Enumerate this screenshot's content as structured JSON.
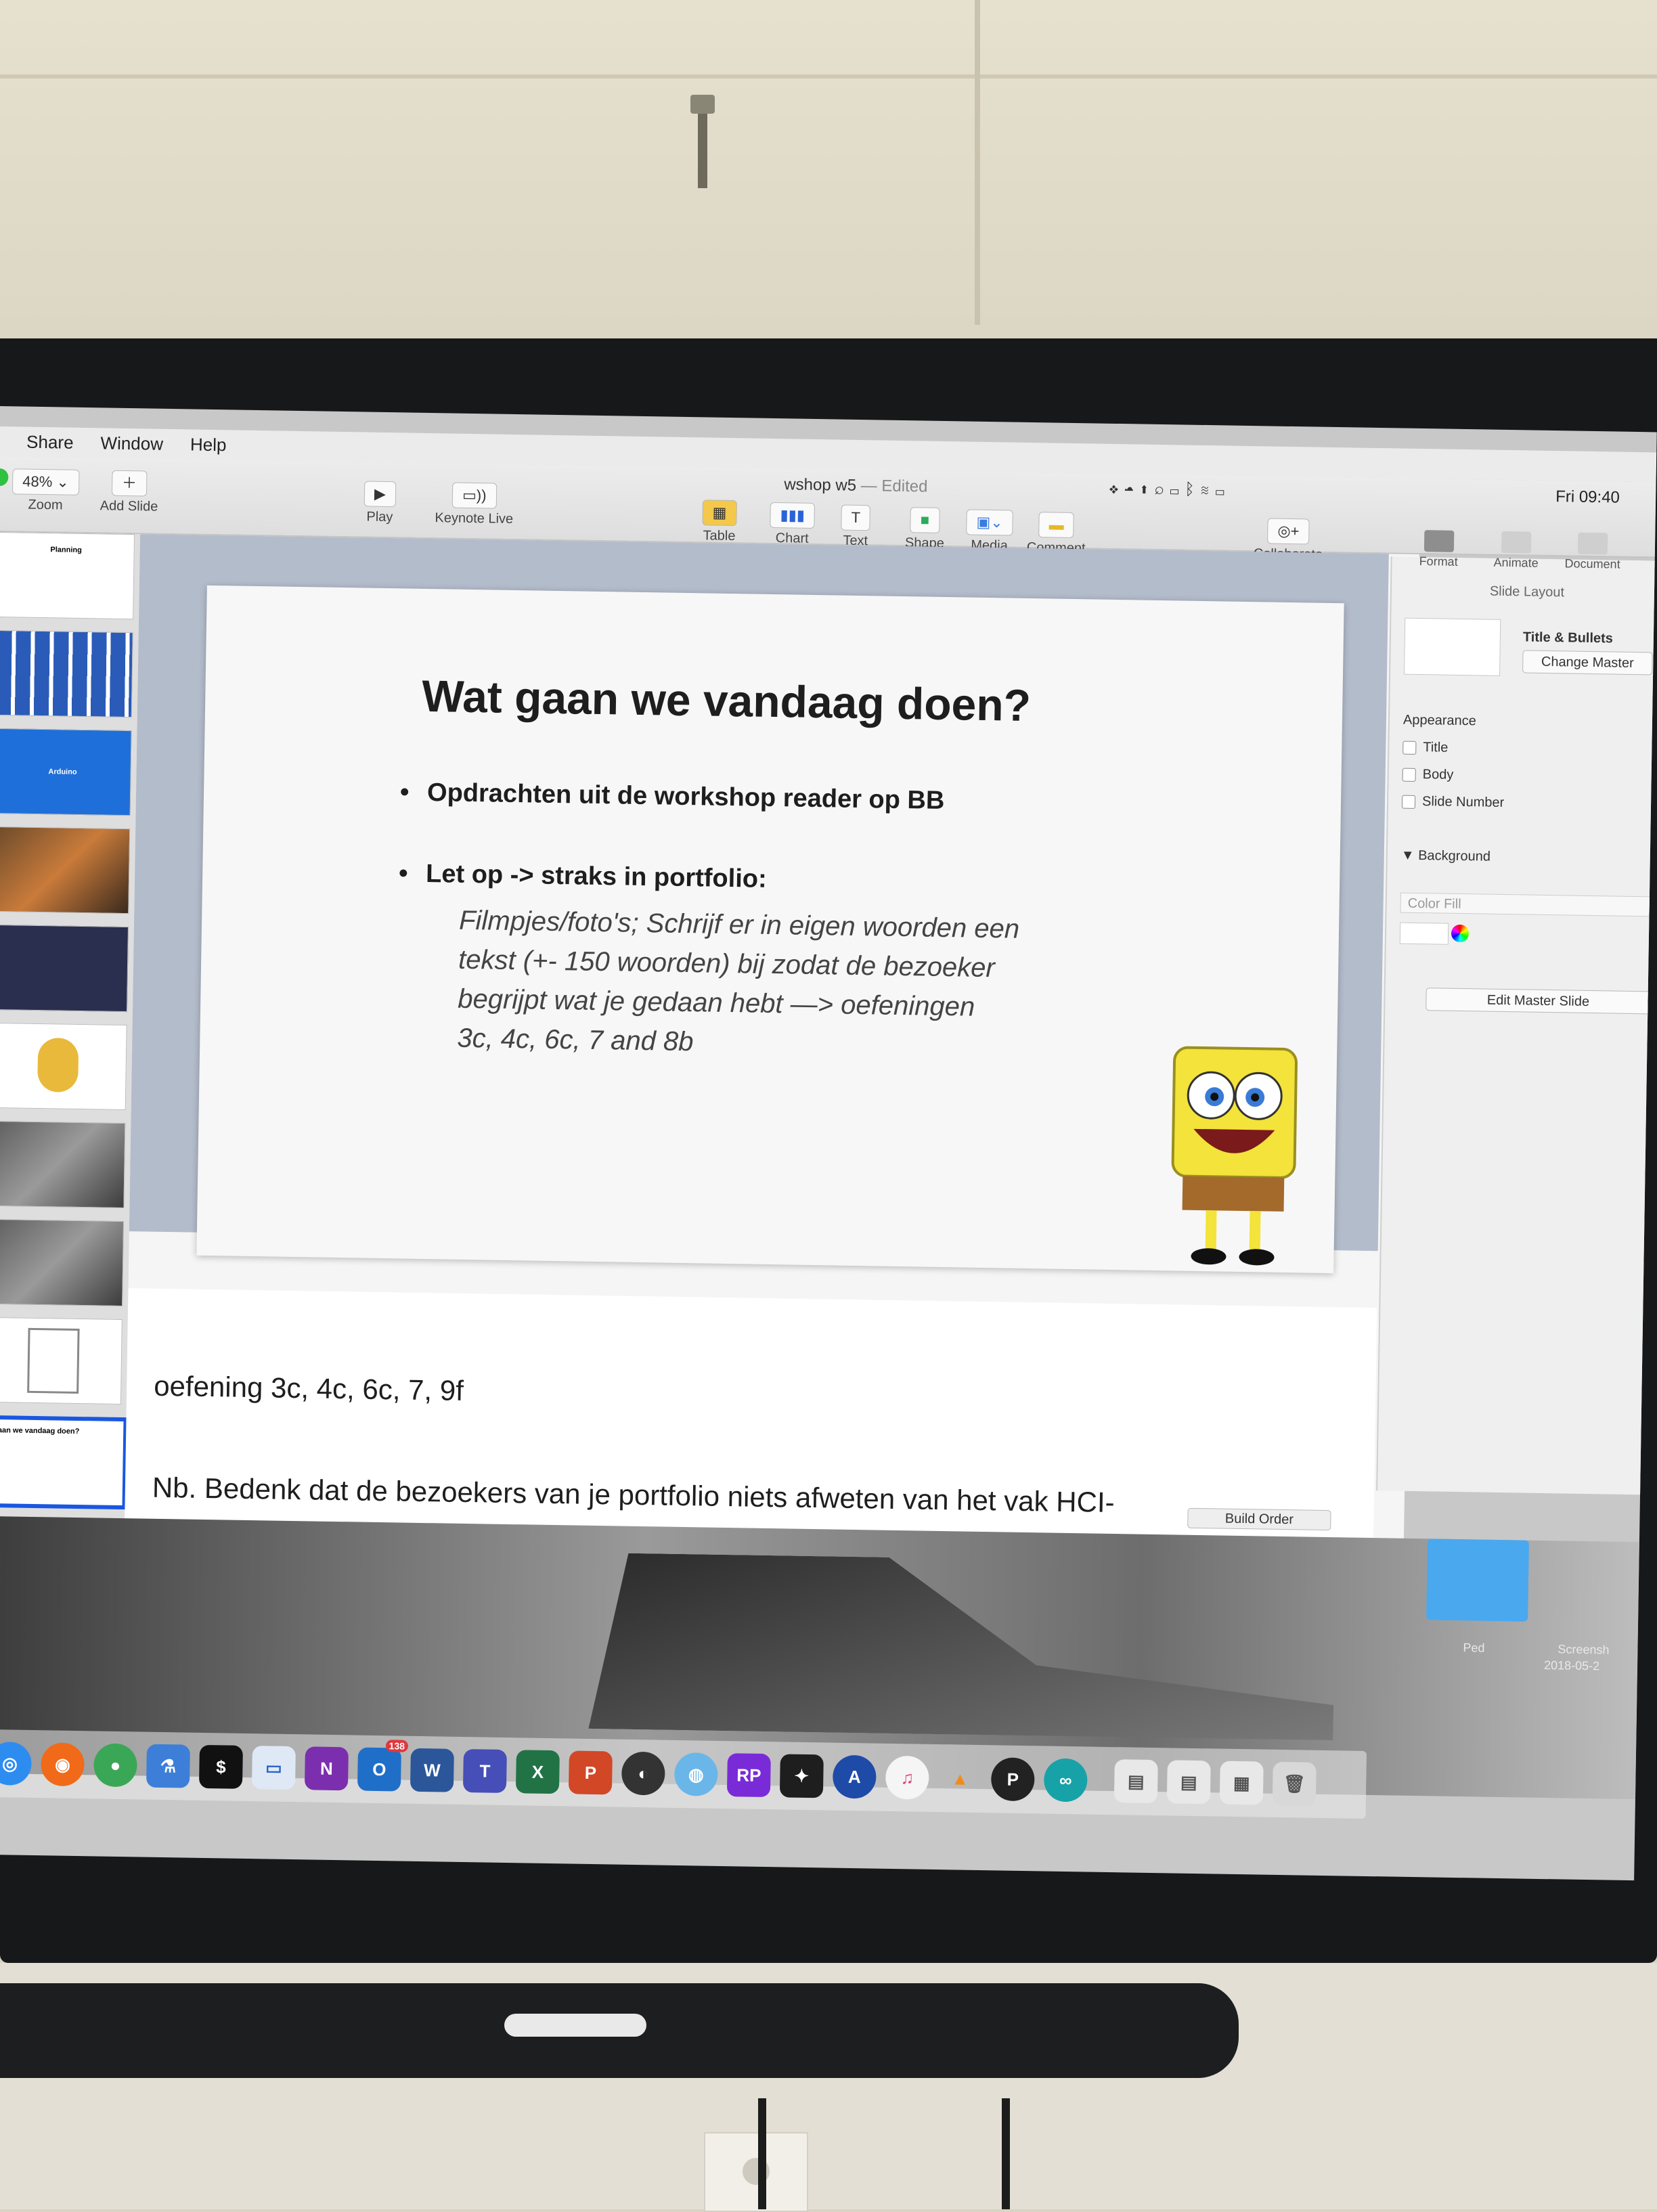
{
  "menubar": {
    "items": [
      "Share",
      "Window",
      "Help"
    ]
  },
  "toolbar": {
    "zoom_value": "48%",
    "zoom_label": "Zoom",
    "add_slide_label": "Add Slide",
    "play_label": "Play",
    "keynote_live_label": "Keynote Live",
    "table_label": "Table",
    "chart_label": "Chart",
    "text_label": "Text",
    "shape_label": "Shape",
    "media_label": "Media",
    "comment_label": "Comment",
    "collaborate_label": "Collaborate",
    "doc_title": "wshop w5",
    "doc_status": "— Edited"
  },
  "status_bar": {
    "clock": "Fri 09:40"
  },
  "inspector": {
    "tabs": [
      "Format",
      "Animate",
      "Document"
    ],
    "header": "Slide Layout",
    "layout_name": "Title & Bullets",
    "change_master": "Change Master",
    "appearance": "Appearance",
    "appearance_options": [
      "Title",
      "Body",
      "Slide Number"
    ],
    "background": "Background",
    "color_fill": "Color Fill",
    "edit_master": "Edit Master Slide",
    "build_order": "Build Order"
  },
  "thumbnails": {
    "planning_title": "Planning",
    "arduino_title": "Arduino",
    "selected_title": "gaan we vandaag doen?"
  },
  "slide": {
    "title": "Wat gaan we vandaag doen?",
    "bullet1": "Opdrachten uit de workshop reader op BB",
    "bullet2": "Let op -> straks in portfolio:",
    "bullet2_detail_lines": [
      "Filmpjes/foto's; Schrijf er in eigen woorden een",
      "tekst (+- 150 woorden) bij zodat de bezoeker",
      "begrijpt wat je gedaan hebt —> oefeningen",
      "3c, 4c, 6c, 7 and 8b"
    ]
  },
  "notes": {
    "line1": "oefening 3c, 4c, 6c, 7, 9f",
    "line2": "Nb. Bedenk dat de bezoekers van je portfolio niets afweten van het vak HCI-"
  },
  "desktop": {
    "folder_label": "Ped",
    "screenshot_label": "Screensh",
    "screenshot_date": "2018-05-2"
  },
  "dock_badge": "138"
}
